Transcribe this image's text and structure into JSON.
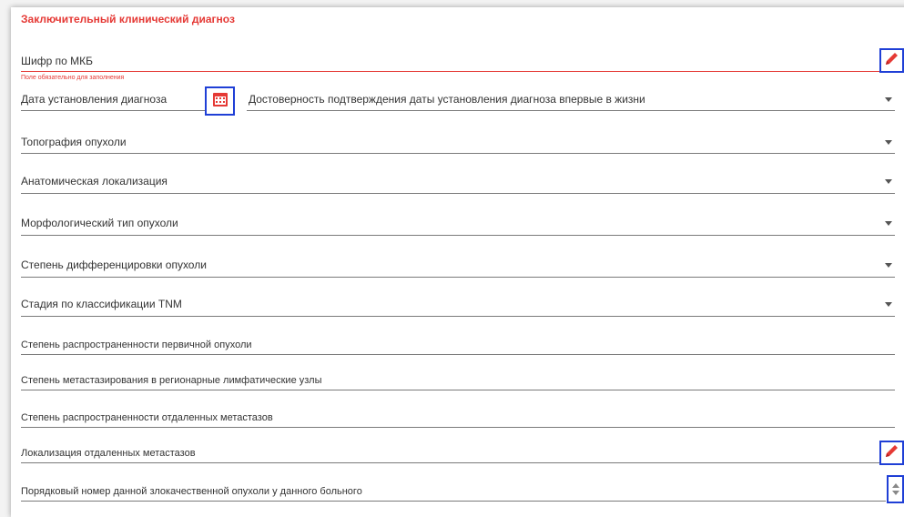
{
  "section": {
    "title": "Заключительный клинический диагноз"
  },
  "fields": {
    "icd_code": {
      "label": "Шифр по МКБ",
      "required_hint": "Поле обязательно для заполнения"
    },
    "diagnosis_date": {
      "label": "Дата установления диагноза"
    },
    "date_reliability": {
      "label": "Достоверность подтверждения даты установления диагноза впервые в жизни"
    },
    "tumor_topography": {
      "label": "Топография опухоли"
    },
    "anatomic_localization": {
      "label": "Анатомическая локализация"
    },
    "morphological_type": {
      "label": "Морфологический тип опухоли"
    },
    "differentiation_degree": {
      "label": "Степень дифференцировки опухоли"
    },
    "tnm_stage": {
      "label": "Стадия по классификации TNM"
    },
    "primary_tumor_extent": {
      "label": "Степень распространенности первичной опухоли"
    },
    "regional_lymph_metastasis": {
      "label": "Степень метастазирования в регионарные лимфатические узлы"
    },
    "distant_metastasis_extent": {
      "label": "Степень распространенности отдаленных метастазов"
    },
    "distant_metastasis_localization": {
      "label": "Локализация отдаленных метастазов"
    },
    "tumor_ordinal_number": {
      "label": "Порядковый номер данной злокачественной опухоли у данного больного"
    }
  },
  "icons": {
    "edit": "pencil-icon",
    "calendar": "calendar-icon",
    "dropdown": "chevron-down-icon",
    "spinner": "number-stepper-icon"
  },
  "colors": {
    "accent": "#e53935",
    "highlight_box": "#1f3fd6"
  }
}
